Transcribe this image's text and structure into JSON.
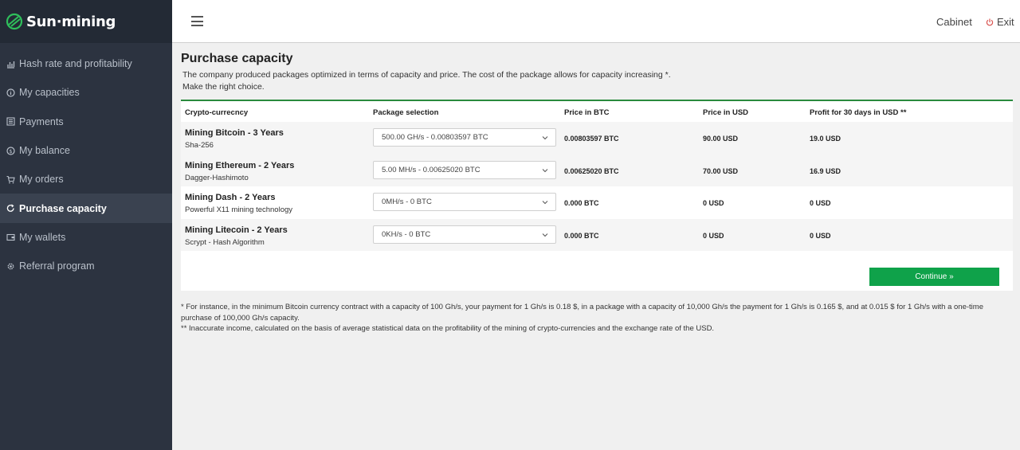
{
  "brand": {
    "name": "Sun·mining"
  },
  "sidebar": {
    "items": [
      {
        "label": "Hash rate and profitability",
        "icon": "chart-icon"
      },
      {
        "label": "My capacities",
        "icon": "info-icon"
      },
      {
        "label": "Payments",
        "icon": "list-icon"
      },
      {
        "label": "My balance",
        "icon": "coin-icon"
      },
      {
        "label": "My orders",
        "icon": "cart-icon"
      },
      {
        "label": "Purchase capacity",
        "icon": "refresh-icon",
        "active": true
      },
      {
        "label": "My wallets",
        "icon": "wallet-icon"
      },
      {
        "label": "Referral program",
        "icon": "gear-icon"
      }
    ]
  },
  "header": {
    "cabinet": "Cabinet",
    "exit": "Exit"
  },
  "page": {
    "title": "Purchase capacity",
    "desc_line1": "The company produced packages optimized in terms of capacity and price. The cost of the package allows for capacity increasing *.",
    "desc_line2": "Make the right choice."
  },
  "table": {
    "columns": [
      "Crypto-currecncy",
      "Package selection",
      "Price in BTC",
      "Price in USD",
      "Profit for 30 days in USD **"
    ],
    "rows": [
      {
        "name": "Mining Bitcoin - 3 Years",
        "algo": "Sha-256",
        "package": "500.00 GH/s - 0.00803597 BTC",
        "price_btc": "0.00803597 BTC",
        "price_usd": "90.00 USD",
        "profit": "19.0 USD"
      },
      {
        "name": "Mining Ethereum - 2 Years",
        "algo": "Dagger-Hashimoto",
        "package": "5.00 MH/s - 0.00625020 BTC",
        "price_btc": "0.00625020 BTC",
        "price_usd": "70.00 USD",
        "profit": "16.9 USD"
      },
      {
        "name": "Mining Dash - 2 Years",
        "algo": "Powerful X11 mining technology",
        "package": "0MH/s - 0 BTC",
        "price_btc": "0.000 BTC",
        "price_usd": "0 USD",
        "profit": "0 USD"
      },
      {
        "name": "Mining Litecoin - 2 Years",
        "algo": "Scrypt - Hash Algorithm",
        "package": "0KH/s - 0 BTC",
        "price_btc": "0.000 BTC",
        "price_usd": "0 USD",
        "profit": "0 USD"
      }
    ],
    "continue_label": "Continue »"
  },
  "footnotes": {
    "note1": "* For instance, in the minimum Bitcoin currency contract with a capacity of 100 Gh/s, your payment for 1 Gh/s is 0.18 $, in a package with a capacity of 10,000 Gh/s the payment for 1 Gh/s is 0.165 $, and at 0.015 $ for 1 Gh/s with a one-time purchase of 100,000 Gh/s capacity.",
    "note2": "** Inaccurate income, calculated on the basis of average statistical data on the profitability of the mining of crypto-currencies and the exchange rate of the USD."
  },
  "colors": {
    "accent": "#0fa24a",
    "sidebar": "#2c3340",
    "panel_border": "#2a8a3d"
  }
}
